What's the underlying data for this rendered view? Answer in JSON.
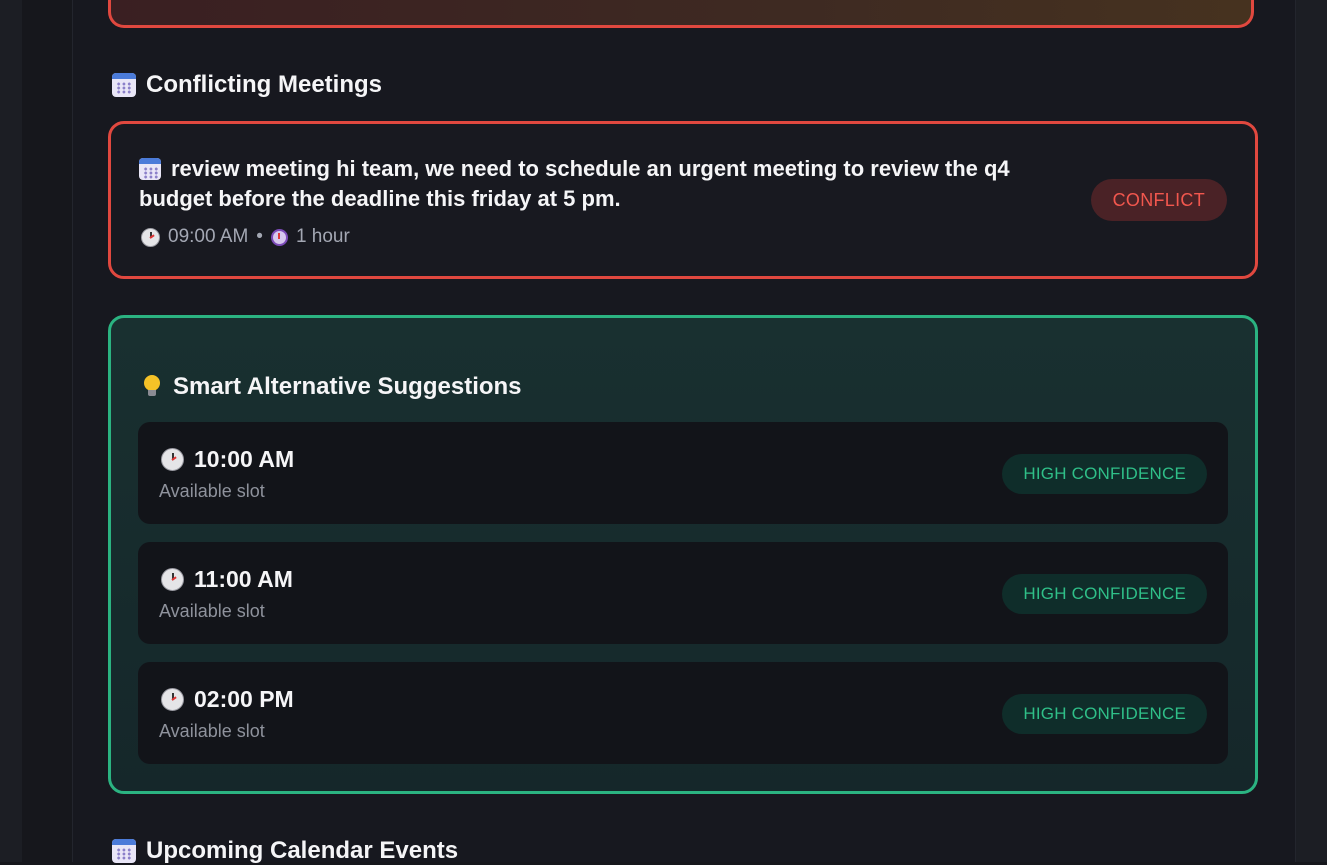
{
  "conflicting_section": {
    "title": "Conflicting Meetings",
    "icon": "calendar-icon"
  },
  "conflict_meeting": {
    "title": "review meeting hi team, we need to schedule an urgent meeting to review the q4 budget before the deadline this friday at 5 pm.",
    "time": "09:00 AM",
    "separator": "•",
    "duration": "1 hour",
    "badge": "CONFLICT",
    "colors": {
      "border": "#e0483f",
      "badge_text": "#f2574e"
    }
  },
  "suggestions": {
    "title": "Smart Alternative Suggestions",
    "icon": "lightbulb-icon",
    "colors": {
      "border": "#2bb381",
      "badge_text": "#2fbf88"
    },
    "items": [
      {
        "time": "10:00 AM",
        "status": "Available slot",
        "confidence": "HIGH CONFIDENCE"
      },
      {
        "time": "11:00 AM",
        "status": "Available slot",
        "confidence": "HIGH CONFIDENCE"
      },
      {
        "time": "02:00 PM",
        "status": "Available slot",
        "confidence": "HIGH CONFIDENCE"
      }
    ]
  },
  "upcoming_section": {
    "title": "Upcoming Calendar Events",
    "icon": "calendar-icon"
  }
}
